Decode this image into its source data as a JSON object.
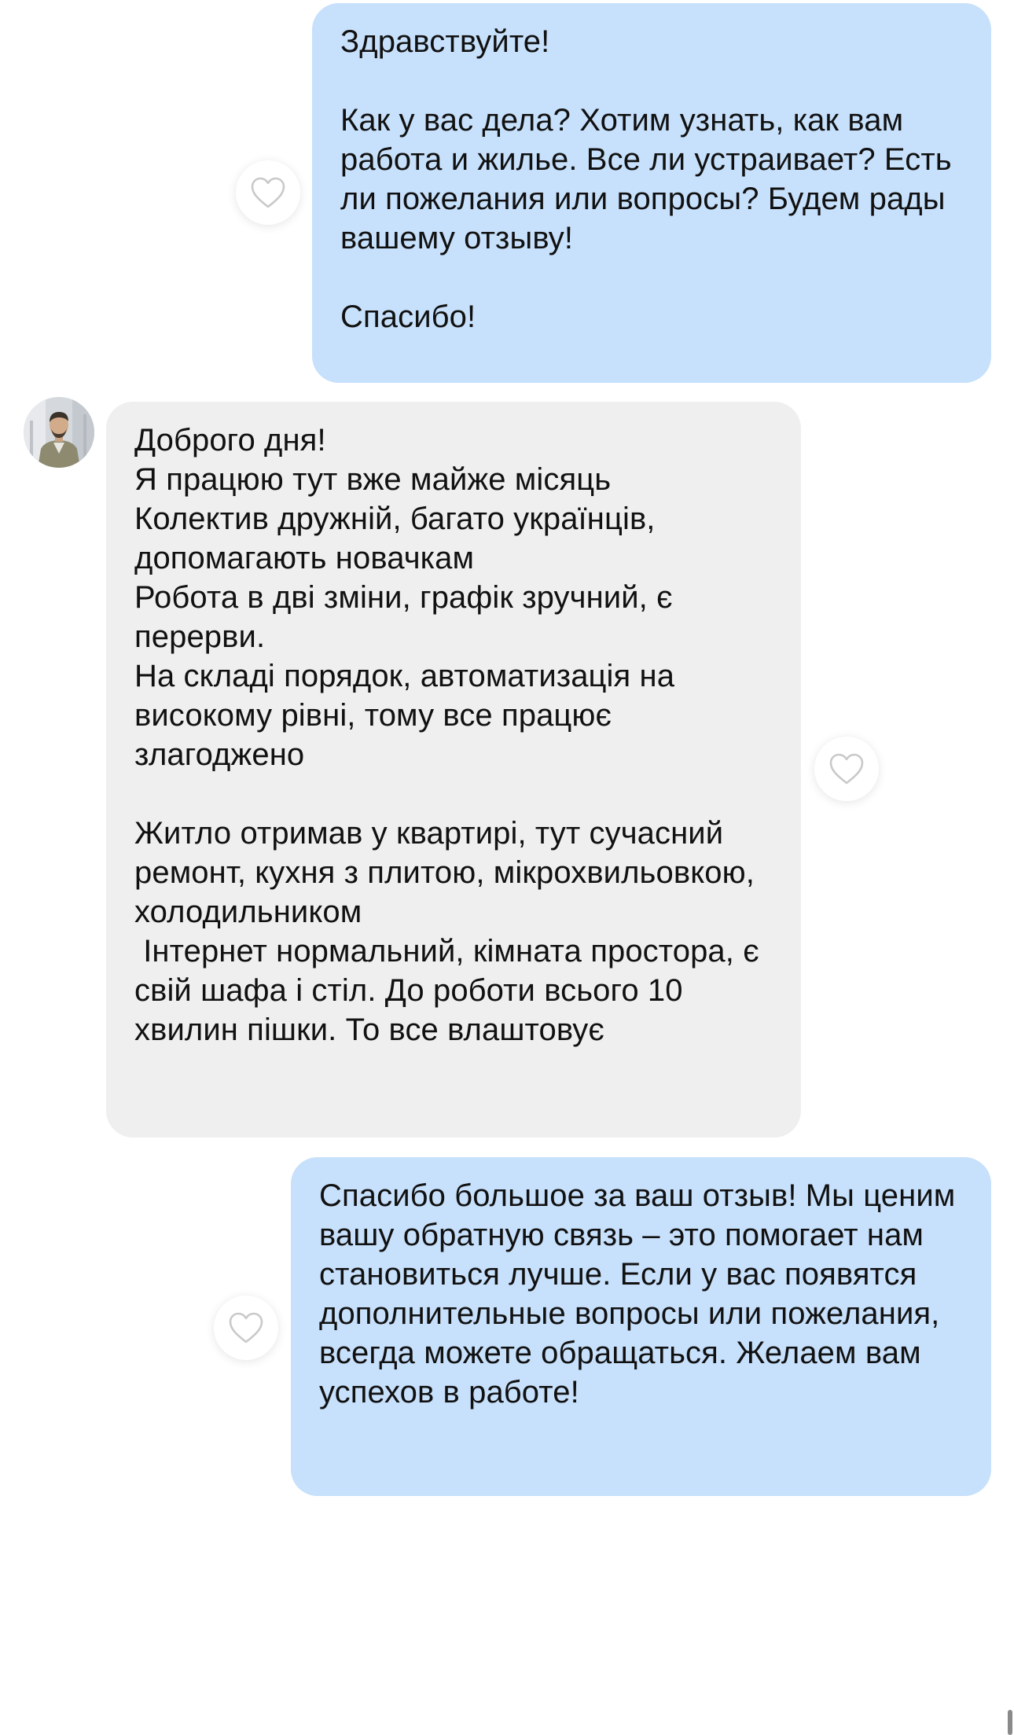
{
  "messages": [
    {
      "direction": "outgoing",
      "text": "Здравствуйте!\n\nКак у вас дела? Хотим узнать, как вам работа и жилье. Все ли устраивает? Есть ли пожелания или вопросы? Будем рады вашему отзыву!\n\nСпасибо!"
    },
    {
      "direction": "incoming",
      "text": "Доброго дня!\nЯ працюю тут вже майже місяць\nКолектив дружній, багато українців, допомагають новачкам\nРобота в дві зміни, графік зручний, є перерви.\nНа складі порядок, автоматизація на високому рівні, тому все працює злагоджено\n\nЖитло отримав у квартирі, тут сучасний ремонт, кухня з плитою, мікрохвильовкою, холодильником\n Інтернет нормальний, кімната простора, є свій шафа і стіл. До роботи всього 10 хвилин пішки. То все влаштовує"
    },
    {
      "direction": "outgoing",
      "text": "Спасибо большое за ваш отзыв! Мы ценим вашу обратную связь – это помогает нам становиться лучше. Если у вас появятся дополнительные вопросы или пожелания, всегда можете обращаться. Желаем вам успехов в работе!"
    }
  ],
  "icons": {
    "like": "heart-outline-icon",
    "avatar": "user-avatar"
  },
  "colors": {
    "outgoing_bubble": "#c7e0fb",
    "incoming_bubble": "#efefef",
    "background": "#ffffff",
    "heart_stroke": "#c9c9c9"
  }
}
